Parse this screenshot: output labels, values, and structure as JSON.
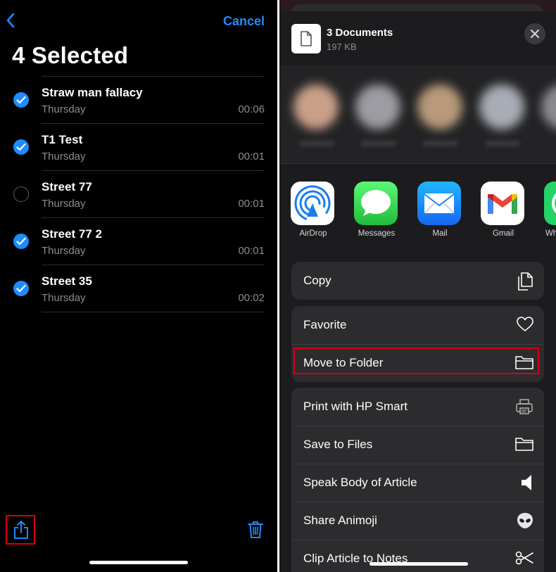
{
  "left_screen": {
    "nav": {
      "cancel_label": "Cancel"
    },
    "title": "4 Selected",
    "recordings": [
      {
        "title": "Straw man fallacy",
        "date": "Thursday",
        "duration": "00:06",
        "selected": true
      },
      {
        "title": "T1 Test",
        "date": "Thursday",
        "duration": "00:01",
        "selected": true
      },
      {
        "title": "Street 77",
        "date": "Thursday",
        "duration": "00:01",
        "selected": false
      },
      {
        "title": "Street 77 2",
        "date": "Thursday",
        "duration": "00:01",
        "selected": true
      },
      {
        "title": "Street 35",
        "date": "Thursday",
        "duration": "00:02",
        "selected": true
      }
    ],
    "toolbar": {
      "share_icon": "share-icon",
      "trash_icon": "trash-icon"
    },
    "accent_color": "#1e8bff",
    "highlight_color": "#d4001a"
  },
  "share_sheet": {
    "header": {
      "title": "3 Documents",
      "size": "197 KB"
    },
    "apps": [
      {
        "label": "AirDrop",
        "icon": "airdrop-icon"
      },
      {
        "label": "Messages",
        "icon": "messages-icon"
      },
      {
        "label": "Mail",
        "icon": "mail-icon"
      },
      {
        "label": "Gmail",
        "icon": "gmail-icon"
      },
      {
        "label": "Wh",
        "icon": "whatsapp-icon"
      }
    ],
    "actions_group1": [
      {
        "label": "Copy",
        "icon": "copy-icon"
      }
    ],
    "actions_group2": [
      {
        "label": "Favorite",
        "icon": "heart-icon"
      },
      {
        "label": "Move to Folder",
        "icon": "folder-icon"
      }
    ],
    "actions_group3": [
      {
        "label": "Print with HP Smart",
        "icon": "printer-icon"
      },
      {
        "label": "Save to Files",
        "icon": "folder-icon"
      },
      {
        "label": "Speak Body of Article",
        "icon": "speaker-icon"
      },
      {
        "label": "Share Animoji",
        "icon": "alien-icon"
      },
      {
        "label": "Clip Article to Notes",
        "icon": "scissors-icon"
      }
    ]
  }
}
